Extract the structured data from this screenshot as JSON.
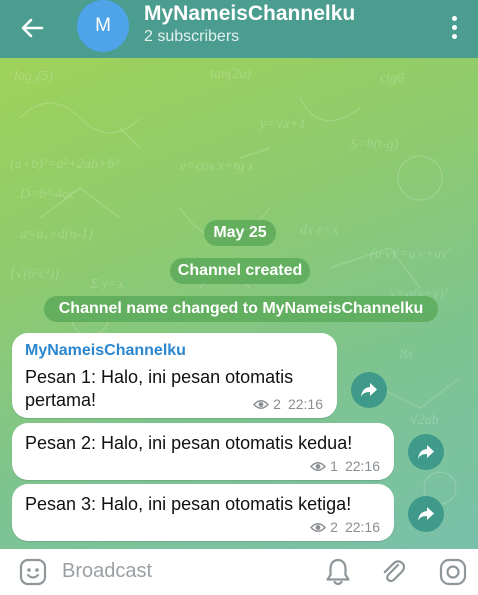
{
  "header": {
    "avatar_letter": "M",
    "title": "MyNameisChannelku",
    "subtitle": "2 subscribers"
  },
  "service": {
    "date": "May 25",
    "created": "Channel created",
    "renamed": "Channel name changed to MyNameisChannelku"
  },
  "messages": [
    {
      "sender": "MyNameisChannelku",
      "line1": "Pesan 1: Halo, ini pesan otomatis",
      "line2": "pertama!",
      "views": "2",
      "time": "22:16"
    },
    {
      "text": "Pesan 2: Halo, ini pesan otomatis kedua!",
      "views": "1",
      "time": "22:16"
    },
    {
      "text": "Pesan 3: Halo, ini pesan otomatis ketiga!",
      "views": "2",
      "time": "22:16"
    }
  ],
  "footer": {
    "placeholder": "Broadcast"
  },
  "colors": {
    "header": "#4a9d8f",
    "accent_blue": "#2a86cf",
    "share_button": "#3f9a8a"
  }
}
